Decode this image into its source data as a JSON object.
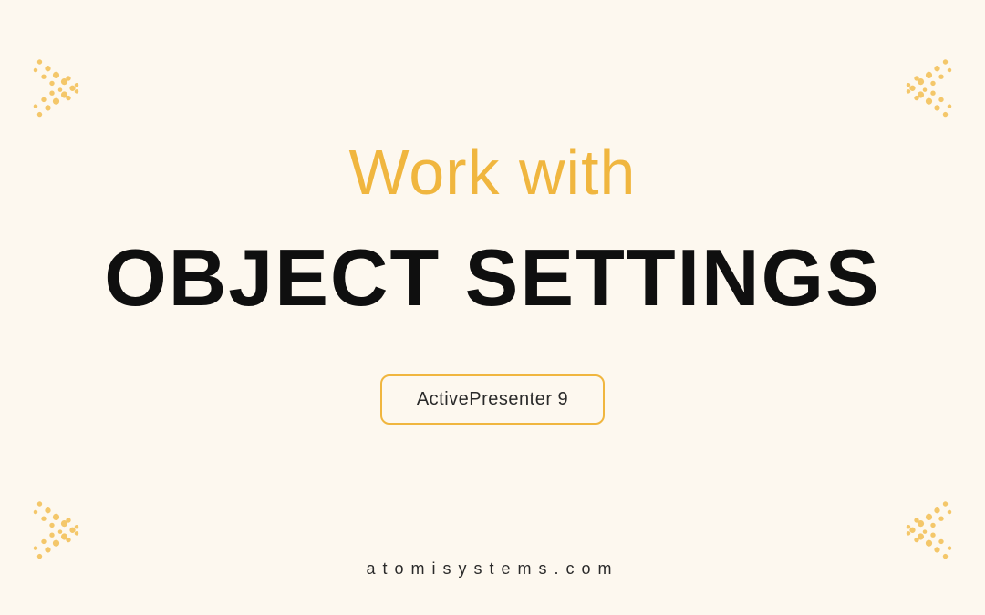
{
  "heading": {
    "top": "Work with",
    "main": "OBJECT SETTINGS"
  },
  "badge": {
    "label": "ActivePresenter 9"
  },
  "footer": {
    "text": "atomisystems.com"
  },
  "colors": {
    "accent": "#f0b63f",
    "background": "#fdf8ef",
    "text_dark": "#0f0f0f"
  }
}
